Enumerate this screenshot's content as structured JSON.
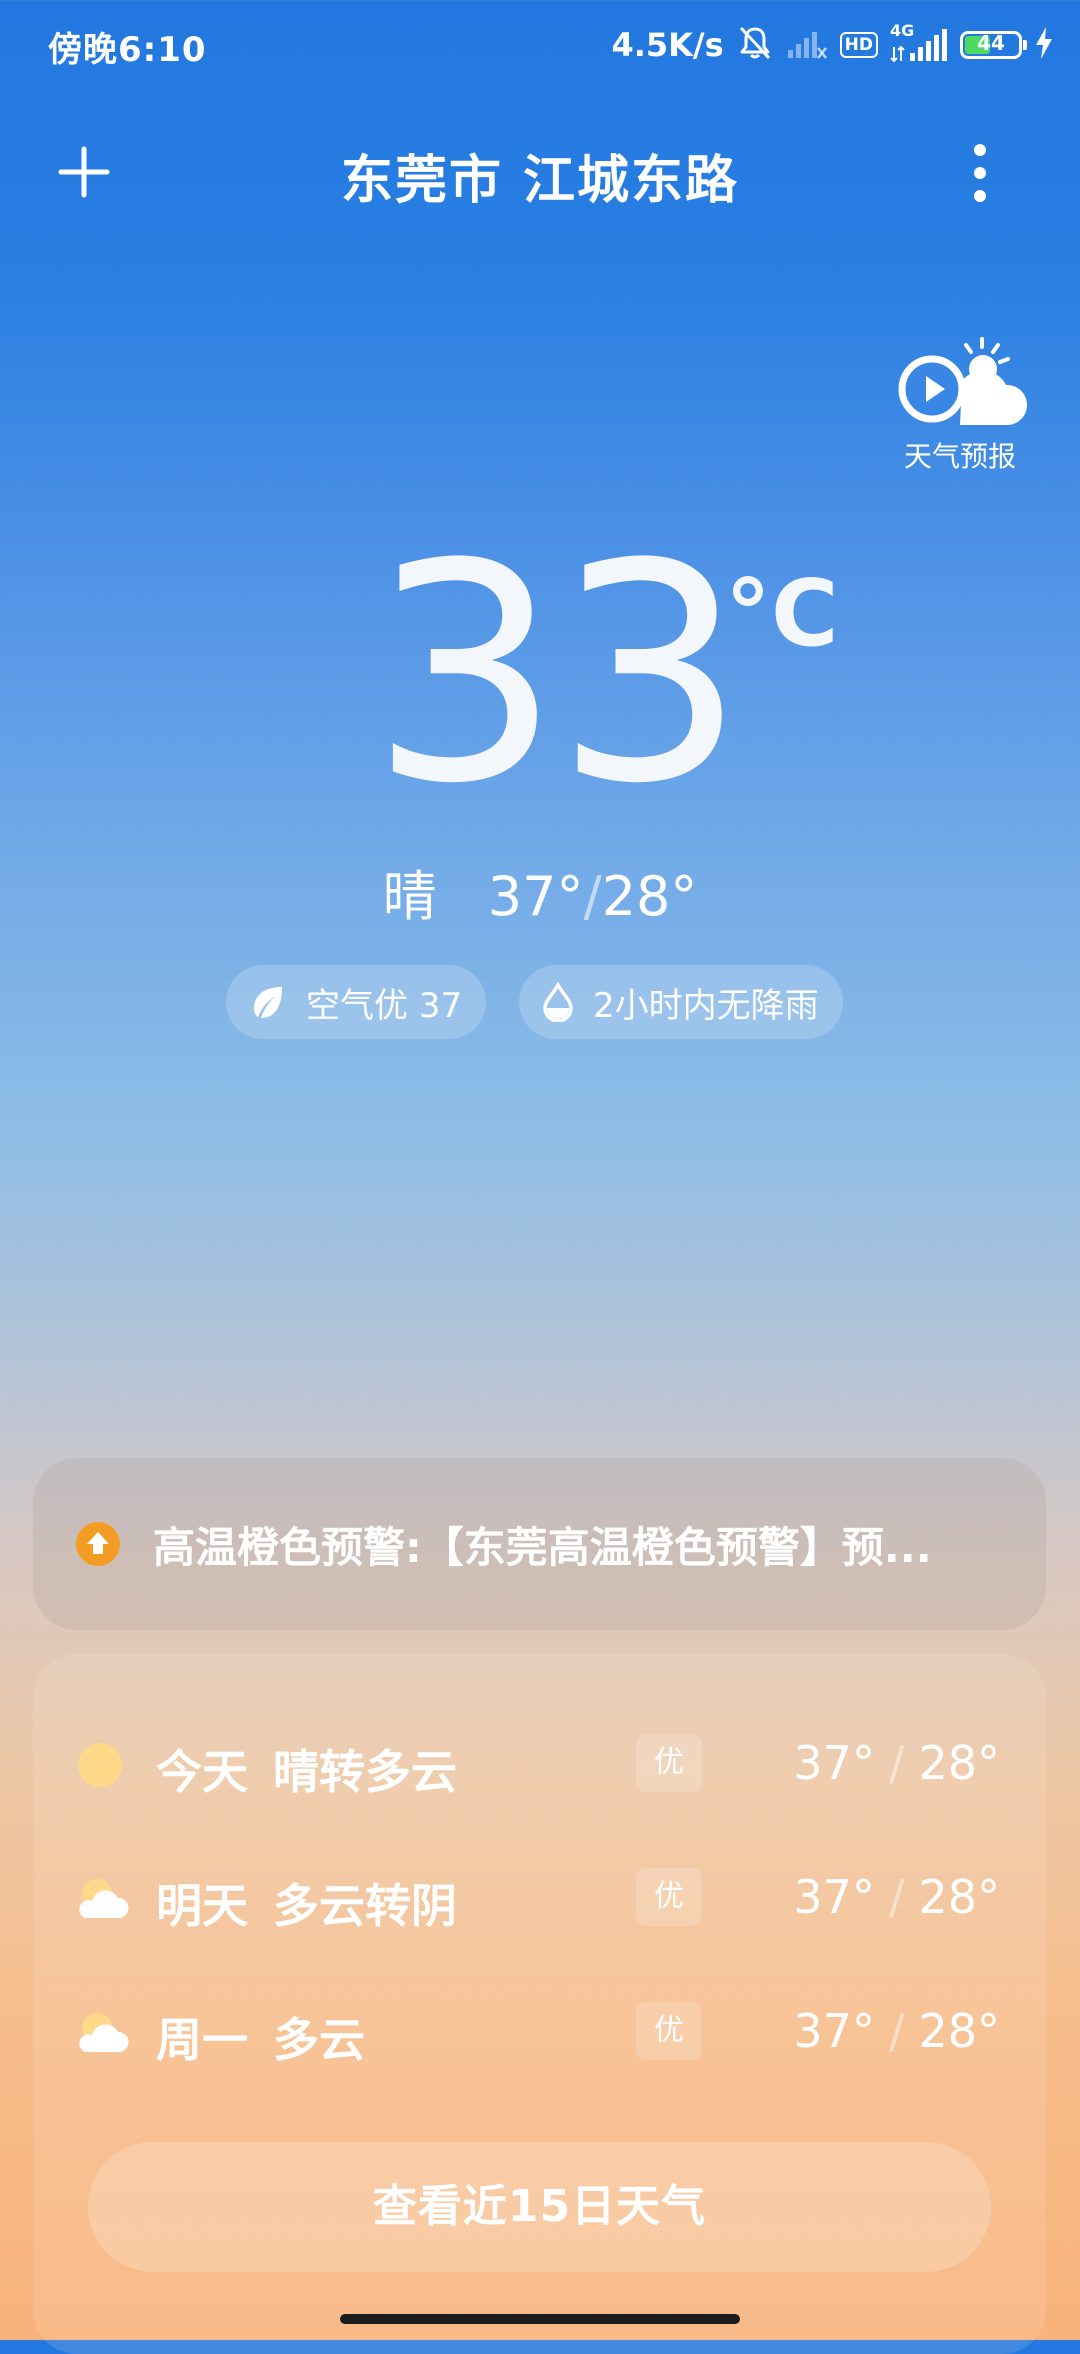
{
  "status_bar": {
    "time": "傍晚6:10",
    "net_speed": "4.5K/s",
    "network_type": "4G",
    "hd_label": "HD",
    "battery_level": "44"
  },
  "header": {
    "location": "东莞市 江城东路"
  },
  "forecast_video": {
    "label": "天气预报"
  },
  "current": {
    "temperature": "33",
    "unit": "°C",
    "condition": "晴",
    "high": "37°",
    "low": "28°",
    "air_quality": "空气优 37",
    "rain_forecast": "2小时内无降雨"
  },
  "alert": {
    "text": "高温橙色预警:【东莞高温橙色预警】预..."
  },
  "forecast": [
    {
      "day": "今天",
      "condition": "晴转多云",
      "aqi": "优",
      "high": "37°",
      "low": "28°",
      "icon": "sun-icon"
    },
    {
      "day": "明天",
      "condition": "多云转阴",
      "aqi": "优",
      "high": "37°",
      "low": "28°",
      "icon": "cloud-sun-icon"
    },
    {
      "day": "周一",
      "condition": "多云",
      "aqi": "优",
      "high": "37°",
      "low": "28°",
      "icon": "cloud-sun-icon"
    }
  ],
  "view_15_days": "查看近15日天气",
  "colors": {
    "sky_top": "#2278e0",
    "sky_bottom": "#f8b27a",
    "alert_orange": "#f39c24",
    "sun_yellow": "#ffd98a"
  }
}
